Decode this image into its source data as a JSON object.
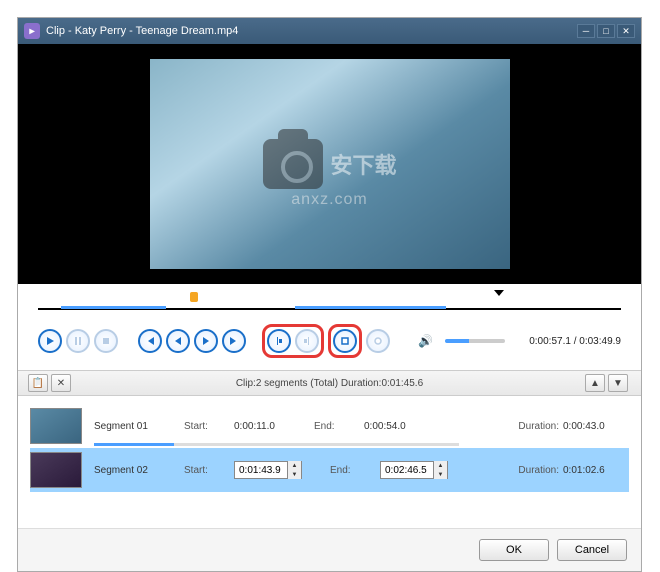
{
  "title": "Clip - Katy Perry - Teenage Dream.mp4",
  "watermark": {
    "text": "安下载",
    "sub": "anxz.com"
  },
  "playback": {
    "current": "0:00:57.1",
    "total": "0:03:49.9"
  },
  "segments_toolbar": {
    "info": "Clip:2 segments (Total)      Duration:0:01:45.6"
  },
  "segments": [
    {
      "name": "Segment 01",
      "start_label": "Start:",
      "start": "0:00:11.0",
      "end_label": "End:",
      "end": "0:00:54.0",
      "duration_label": "Duration:",
      "duration": "0:00:43.0",
      "progress_pct": 22
    },
    {
      "name": "Segment 02",
      "start_label": "Start:",
      "start": "0:01:43.9",
      "end_label": "End:",
      "end": "0:02:46.5",
      "duration_label": "Duration:",
      "duration": "0:01:02.6",
      "progress_pct": 0
    }
  ],
  "buttons": {
    "ok": "OK",
    "cancel": "Cancel"
  }
}
